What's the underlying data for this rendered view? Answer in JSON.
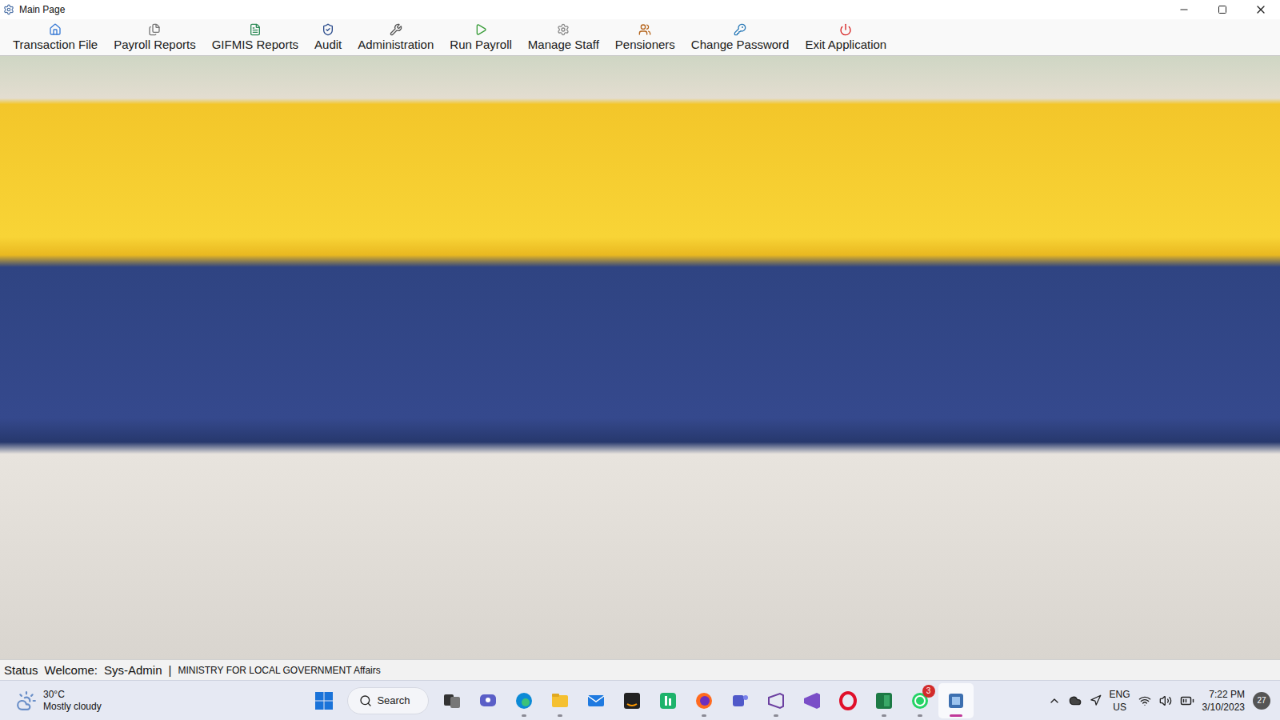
{
  "window": {
    "title": "Main Page"
  },
  "toolbar": [
    {
      "label": "Transaction File",
      "kind": "home"
    },
    {
      "label": "Payroll Reports",
      "kind": "reports"
    },
    {
      "label": "GIFMIS Reports",
      "kind": "document"
    },
    {
      "label": "Audit",
      "kind": "audit"
    },
    {
      "label": "Administration",
      "kind": "tools"
    },
    {
      "label": "Run Payroll",
      "kind": "run"
    },
    {
      "label": "Manage Staff",
      "kind": "gear"
    },
    {
      "label": "Pensioners",
      "kind": "pension"
    },
    {
      "label": "Change Password",
      "kind": "user"
    },
    {
      "label": "Exit Application",
      "kind": "power"
    }
  ],
  "status_bar": {
    "label": "Status",
    "welcome": "Welcome:",
    "user": "Sys-Admin",
    "separator": "|",
    "organization": "MINISTRY FOR LOCAL GOVERNMENT Affairs"
  },
  "taskbar": {
    "weather": {
      "temperature": "30°C",
      "condition": "Mostly cloudy"
    },
    "search": {
      "label": "Search"
    },
    "apps": [
      {
        "kind": "task-view",
        "running": false,
        "active": false,
        "badge": ""
      },
      {
        "kind": "chat",
        "running": false,
        "active": false,
        "badge": ""
      },
      {
        "kind": "edge",
        "running": true,
        "active": false,
        "badge": ""
      },
      {
        "kind": "explorer",
        "running": true,
        "active": false,
        "badge": ""
      },
      {
        "kind": "mail",
        "running": false,
        "active": false,
        "badge": ""
      },
      {
        "kind": "amazon",
        "running": false,
        "active": false,
        "badge": ""
      },
      {
        "kind": "green-app",
        "running": false,
        "active": false,
        "badge": ""
      },
      {
        "kind": "firefox",
        "running": true,
        "active": false,
        "badge": ""
      },
      {
        "kind": "teams",
        "running": false,
        "active": false,
        "badge": ""
      },
      {
        "kind": "visual-studio",
        "running": true,
        "active": false,
        "badge": ""
      },
      {
        "kind": "vs-purple",
        "running": false,
        "active": false,
        "badge": ""
      },
      {
        "kind": "opera",
        "running": false,
        "active": false,
        "badge": ""
      },
      {
        "kind": "excel",
        "running": true,
        "active": false,
        "badge": ""
      },
      {
        "kind": "whatsapp",
        "running": true,
        "active": false,
        "badge": "3"
      },
      {
        "kind": "payroll-app",
        "running": true,
        "active": true,
        "badge": ""
      }
    ],
    "language": "ENG",
    "region": "US",
    "time": "7:22 PM",
    "date": "3/10/2023",
    "notifications": "27"
  }
}
